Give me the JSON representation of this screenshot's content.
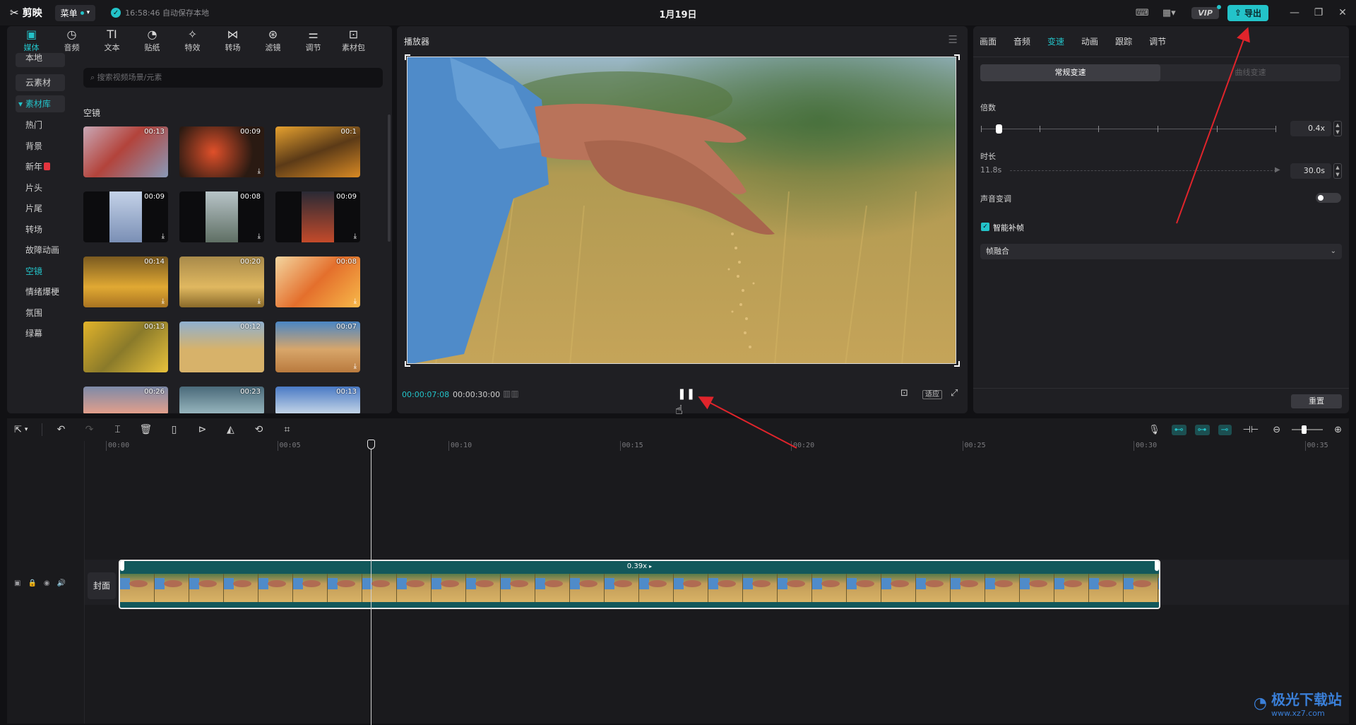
{
  "app": {
    "logo_text": "剪映",
    "menu_label": "菜单",
    "autosave_text": "16:58:46 自动保存本地",
    "project_title": "1月19日",
    "vip_label": "VIP",
    "export_label": "导出"
  },
  "media_tabs": [
    {
      "label": "媒体",
      "icon": "media-icon"
    },
    {
      "label": "音频",
      "icon": "audio-icon"
    },
    {
      "label": "文本",
      "icon": "text-icon"
    },
    {
      "label": "贴纸",
      "icon": "sticker-icon"
    },
    {
      "label": "特效",
      "icon": "effects-icon"
    },
    {
      "label": "转场",
      "icon": "transition-icon"
    },
    {
      "label": "滤镜",
      "icon": "filter-icon"
    },
    {
      "label": "调节",
      "icon": "adjust-icon"
    },
    {
      "label": "素材包",
      "icon": "package-icon"
    }
  ],
  "categories": {
    "local": "本地",
    "cloud": "云素材",
    "library": "素材库",
    "items": [
      "热门",
      "背景",
      "新年",
      "片头",
      "片尾",
      "转场",
      "故障动画",
      "空镜",
      "情绪爆梗",
      "氛围",
      "绿幕"
    ],
    "active": "空镜"
  },
  "search": {
    "placeholder": "搜索视频场景/元素"
  },
  "section_title": "空镜",
  "thumbnails": [
    {
      "duration": "00:13",
      "download": false
    },
    {
      "duration": "00:09",
      "download": true
    },
    {
      "duration": "00:1",
      "download": false
    },
    {
      "duration": "00:09",
      "download": true
    },
    {
      "duration": "00:08",
      "download": true
    },
    {
      "duration": "00:09",
      "download": true
    },
    {
      "duration": "00:14",
      "download": true
    },
    {
      "duration": "00:20",
      "download": true
    },
    {
      "duration": "00:08",
      "download": true
    },
    {
      "duration": "00:13",
      "download": false
    },
    {
      "duration": "00:12",
      "download": false
    },
    {
      "duration": "00:07",
      "download": true
    },
    {
      "duration": "00:26",
      "download": false
    },
    {
      "duration": "00:23",
      "download": false
    },
    {
      "duration": "00:13",
      "download": false
    }
  ],
  "player": {
    "title": "播放器",
    "current_time": "00:00:07:08",
    "total_time": "00:00:30:00",
    "fit_label": "适应"
  },
  "right_panel": {
    "tabs": [
      "画面",
      "音频",
      "变速",
      "动画",
      "跟踪",
      "调节"
    ],
    "active_tab": "变速",
    "speed_modes": [
      "常规变速",
      "曲线变速"
    ],
    "multiplier_label": "倍数",
    "multiplier_value": "0.4x",
    "multiplier_fraction": 0.04,
    "duration_label": "时长",
    "duration_from": "11.8s",
    "duration_value": "30.0s",
    "pitch_label": "声音变调",
    "pitch_enabled": false,
    "smart_frame_label": "智能补帧",
    "smart_frame_checked": true,
    "frame_mode": "帧融合",
    "reset_label": "重置"
  },
  "timeline": {
    "ticks": [
      "00:00",
      "00:05",
      "00:10",
      "00:15",
      "00:20",
      "00:25",
      "00:30",
      "00:35"
    ],
    "cover_label": "封面",
    "clip_speed_label": "0.39x",
    "playhead_seconds": 7.3
  },
  "watermark": {
    "main": "极光下载站",
    "sub": "www.xz7.com"
  },
  "colors": {
    "accent": "#23c3c9",
    "arrow": "#e0242b",
    "clip": "#12585b"
  }
}
